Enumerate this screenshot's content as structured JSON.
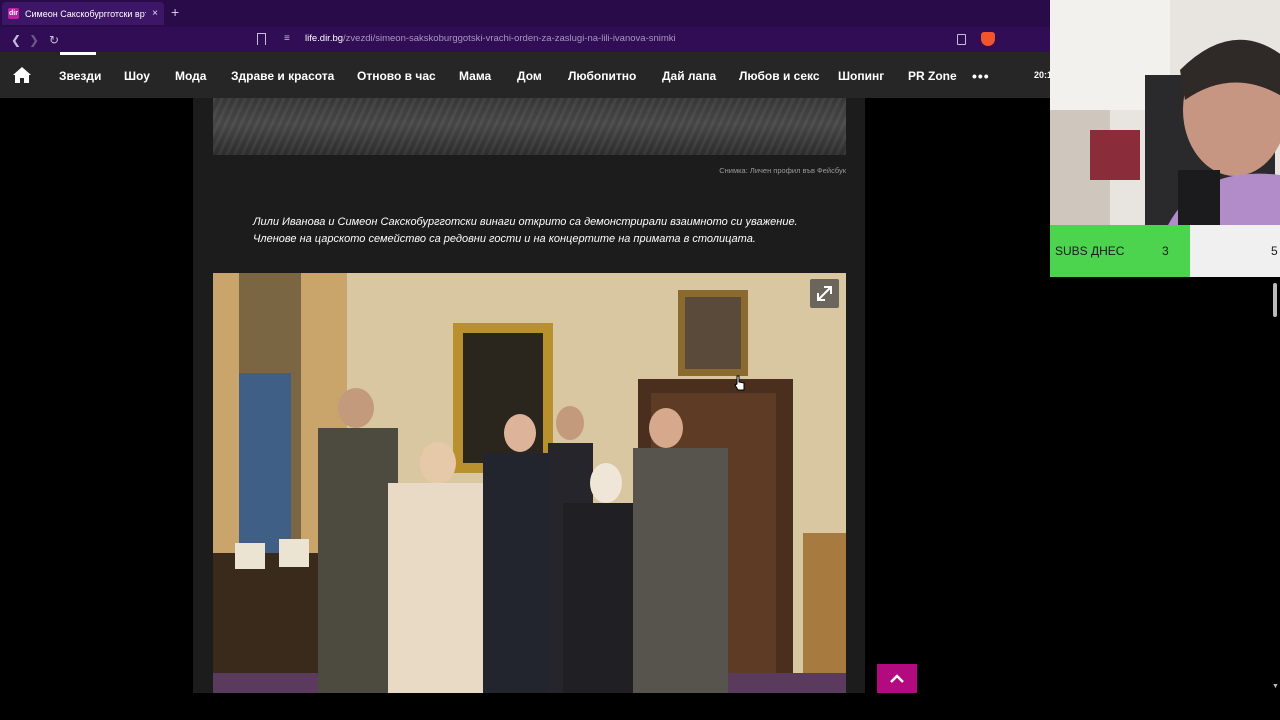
{
  "browser": {
    "tab_title": "Симеон Сакскобургготски връ",
    "tab_favicon": "dir",
    "tab_close": "×",
    "new_tab": "+",
    "url_host": "life.dir.bg",
    "url_path": "/zvezdi/simeon-sakskoburggotski-vrachi-orden-za-zaslugi-na-lili-ivanova-snimki"
  },
  "site_nav": {
    "items": [
      "Звезди",
      "Шоу",
      "Мода",
      "Здраве и красота",
      "Отново в час",
      "Мама",
      "Дом",
      "Любопитно",
      "Дай лапа",
      "Любов и секс",
      "Шопинг",
      "PR Zone"
    ],
    "more": "•••",
    "time": "20:1"
  },
  "article": {
    "caption": "Снимка: Личен профил във Фейсбук",
    "body": "Лили Иванова и Симеон Сакскобургготски винаги открито са демонстрирали взаимното си уважение. Членове на царското семейство са редовни гости и на концертите на примата в столицата."
  },
  "stream_overlay": {
    "subs_label": "SUBS ДНЕС",
    "subs_count": "3",
    "subs_goal": "5"
  },
  "colors": {
    "accent": "#b30a80",
    "subs_green": "#4cd44e",
    "browser_purple": "#2a0b49"
  },
  "icons": [
    "home-icon",
    "expand-icon",
    "arrow-up-icon",
    "back-icon",
    "forward-icon",
    "reload-icon",
    "bookmark-icon"
  ]
}
